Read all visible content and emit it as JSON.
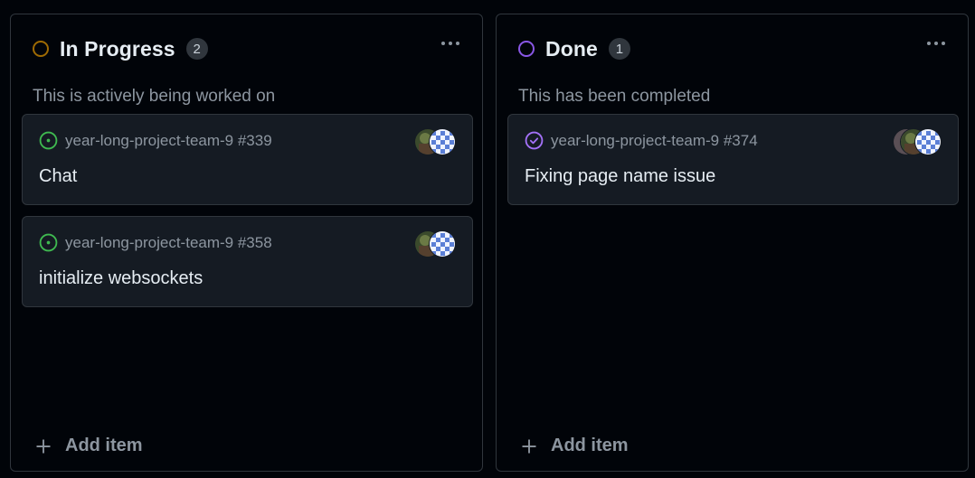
{
  "colors": {
    "in_progress": "#9e6a03",
    "done": "#8957e5",
    "open_issue": "#3fb950",
    "closed_issue": "#a371f7"
  },
  "columns": [
    {
      "title": "In Progress",
      "count": "2",
      "status_icon": "in-progress-circle-icon",
      "description": "This is actively being worked on",
      "add_label": "Add item",
      "cards": [
        {
          "repo": "year-long-project-team-9 #339",
          "title": "Chat",
          "icon": "issue-opened-icon"
        },
        {
          "repo": "year-long-project-team-9 #358",
          "title": "initialize websockets",
          "icon": "issue-opened-icon"
        }
      ]
    },
    {
      "title": "Done",
      "count": "1",
      "status_icon": "done-circle-icon",
      "description": "This has been completed",
      "add_label": "Add item",
      "cards": [
        {
          "repo": "year-long-project-team-9 #374",
          "title": "Fixing page name issue",
          "icon": "issue-closed-icon"
        }
      ]
    }
  ]
}
